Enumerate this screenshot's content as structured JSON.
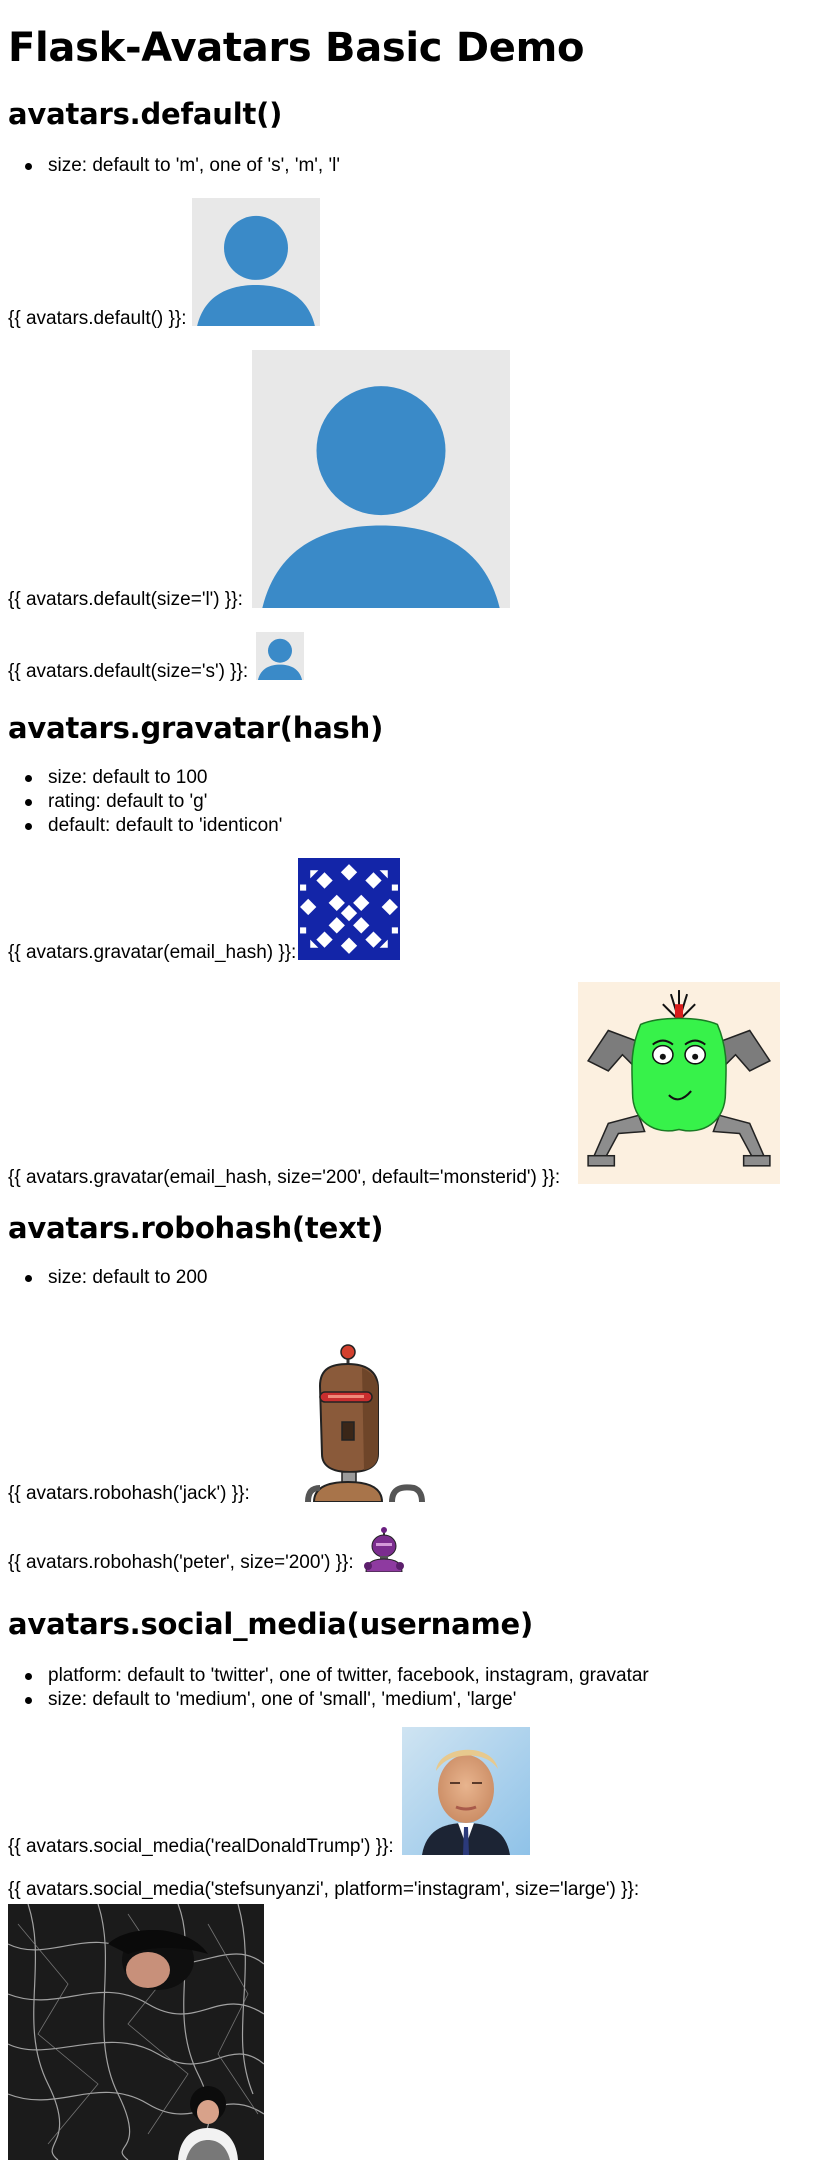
{
  "page": {
    "title": "Flask-Avatars Basic Demo"
  },
  "sections": [
    {
      "heading": "avatars.default()",
      "bullets": [
        "size: default to 'm', one of 's', 'm', 'l'"
      ],
      "examples": [
        "{{ avatars.default() }}:",
        "{{ avatars.default(size='l') }}:",
        "{{ avatars.default(size='s') }}:"
      ]
    },
    {
      "heading": "avatars.gravatar(hash)",
      "bullets": [
        "size: default to 100",
        "rating: default to 'g'",
        "default: default to 'identicon'"
      ],
      "examples": [
        "{{ avatars.gravatar(email_hash) }}:",
        "{{ avatars.gravatar(email_hash, size='200', default='monsterid') }}:"
      ]
    },
    {
      "heading": "avatars.robohash(text)",
      "bullets": [
        "size: default to 200"
      ],
      "examples": [
        "{{ avatars.robohash('jack') }}:",
        "{{ avatars.robohash('peter', size='200') }}:"
      ]
    },
    {
      "heading": "avatars.social_media(username)",
      "bullets": [
        "platform: default to 'twitter', one of twitter, facebook, instagram, gravatar",
        "size: default to 'medium', one of 'small', 'medium', 'large'"
      ],
      "examples": [
        "{{ avatars.social_media('realDonaldTrump') }}:",
        "{{ avatars.social_media('stefsunyanzi', platform='instagram', size='large') }}:"
      ]
    }
  ],
  "colors": {
    "default_avatar_bg": "#e8e8e8",
    "default_avatar_fg": "#3a8ac8",
    "identicon": "#1325a8",
    "monster_body": "#37f24a",
    "monster_bg": "#fcf0e0",
    "robot_body": "#8a5a3a",
    "robot_small": "#7b2d8e"
  },
  "icons": [
    "default-avatar-icon",
    "identicon-image",
    "monster-avatar-image",
    "robot-avatar-image",
    "twitter-photo-image",
    "instagram-photo-image"
  ]
}
